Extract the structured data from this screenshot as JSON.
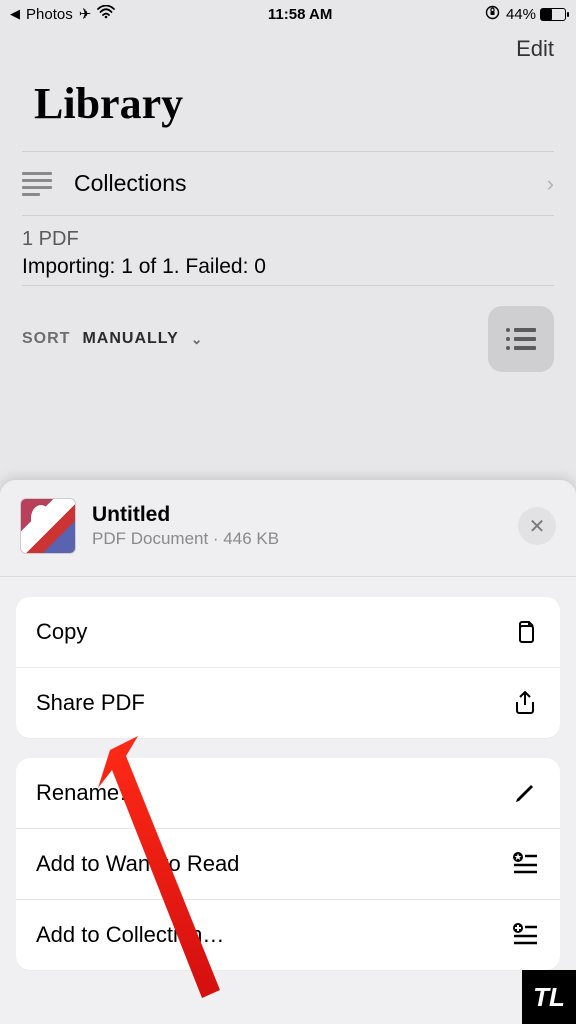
{
  "status_bar": {
    "back_app": "Photos",
    "time": "11:58 AM",
    "battery_pct": "44%"
  },
  "header": {
    "edit": "Edit",
    "title": "Library"
  },
  "collections_row": {
    "label": "Collections"
  },
  "status": {
    "count": "1 PDF",
    "importing": "Importing: 1 of 1. Failed: 0"
  },
  "sort": {
    "label": "SORT",
    "value": "MANUALLY"
  },
  "sheet": {
    "title": "Untitled",
    "subtitle": "PDF Document · 446 KB",
    "group1": [
      {
        "label": "Copy"
      },
      {
        "label": "Share PDF"
      }
    ],
    "group2": [
      {
        "label": "Rename…"
      },
      {
        "label": "Add to Want to Read"
      },
      {
        "label": "Add to Collection…"
      }
    ]
  },
  "watermark": "TL"
}
